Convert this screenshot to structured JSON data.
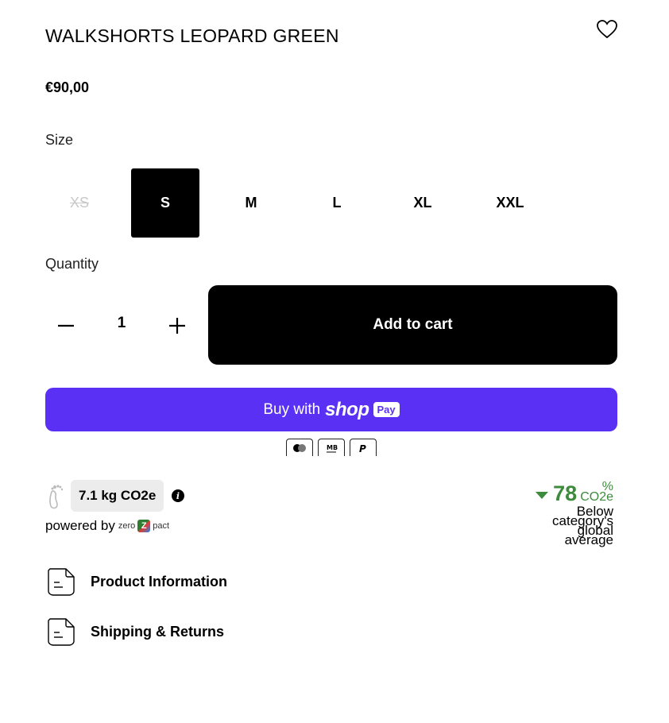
{
  "product": {
    "title": "WALKSHORTS LEOPARD GREEN",
    "price": "€90,00"
  },
  "size": {
    "label": "Size",
    "options": [
      {
        "label": "XS",
        "state": "unavailable"
      },
      {
        "label": "S",
        "state": "selected"
      },
      {
        "label": "M",
        "state": "available"
      },
      {
        "label": "L",
        "state": "available"
      },
      {
        "label": "XL",
        "state": "available"
      },
      {
        "label": "XXL",
        "state": "available"
      }
    ]
  },
  "quantity": {
    "label": "Quantity",
    "value": "1"
  },
  "actions": {
    "add_to_cart": "Add to cart",
    "shop_pay_buy": "Buy with",
    "shop_pay_shop": "shop",
    "shop_pay_pay": "Pay"
  },
  "payment_icons": [
    "mastercard-icon",
    "multibanco-icon",
    "paypal-icon"
  ],
  "carbon": {
    "badge": "7.1 kg CO2e",
    "powered_by": "powered by",
    "logo_text_1": "zero",
    "logo_mark": "Z",
    "logo_text_2": "pact",
    "percent": "78",
    "percent_sign": "%",
    "unit": "CO2e",
    "below_line_1": "Below",
    "below_line_2": "category's",
    "below_line_3": "global",
    "below_line_4": "average",
    "accent_color": "#3d8b3d"
  },
  "accordions": [
    {
      "label": "Product Information"
    },
    {
      "label": "Shipping & Returns"
    }
  ],
  "colors": {
    "shop_pay": "#5a31f4",
    "primary": "#000000"
  }
}
